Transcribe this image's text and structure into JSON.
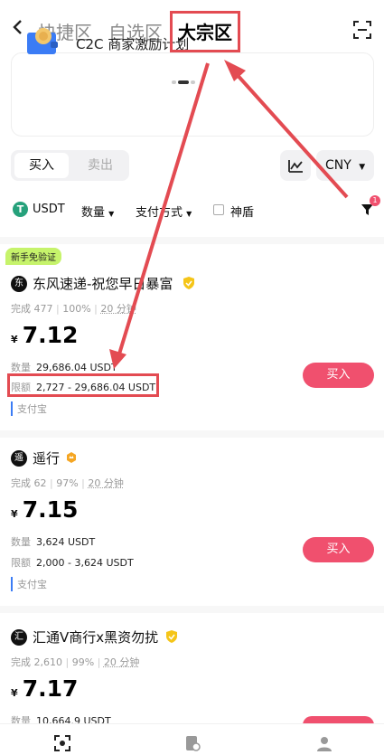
{
  "header": {
    "back_icon": "chevron-left-icon",
    "tabs": [
      {
        "label": "快捷区",
        "active": false
      },
      {
        "label": "自选区",
        "active": false
      },
      {
        "label": "大宗区",
        "active": true
      }
    ],
    "scan_icon": "scan-icon"
  },
  "banner": {
    "text": "C2C 商家激励计划"
  },
  "trade_toggle": {
    "buy": "买入",
    "sell": "卖出"
  },
  "currency": {
    "value": "CNY"
  },
  "filters": {
    "asset": "USDT",
    "amount": "数量",
    "payment": "支付方式",
    "shield": "神盾",
    "badge_count": "1"
  },
  "listings": [
    {
      "tag": "新手免验证",
      "avatar": "东",
      "name": "东风速递-祝您早日暴富",
      "completed": "完成 477",
      "rate": "100%",
      "time": "20 分钟",
      "currency_symbol": "¥",
      "price": "7.12",
      "amount_label": "数量",
      "amount": "29,686.04 USDT",
      "limit_label": "限额",
      "limit": "2,727 - 29,686.04 USDT",
      "payment": "支付宝",
      "button": "买入"
    },
    {
      "avatar": "遥",
      "name": "遥行",
      "completed": "完成 62",
      "rate": "97%",
      "time": "20 分钟",
      "currency_symbol": "¥",
      "price": "7.15",
      "amount_label": "数量",
      "amount": "3,624 USDT",
      "limit_label": "限额",
      "limit": "2,000 - 3,624 USDT",
      "payment": "支付宝",
      "button": "买入"
    },
    {
      "avatar": "汇",
      "name": "汇通V商行x黑资勿扰",
      "completed": "完成 2,610",
      "rate": "99%",
      "time": "20 分钟",
      "currency_symbol": "¥",
      "price": "7.17",
      "amount_label": "数量",
      "amount": "10,664.9 USDT"
    }
  ],
  "colors": {
    "accent": "#f0506e",
    "annotation": "#e34b52",
    "newbie_tag": "#c6f36b"
  }
}
